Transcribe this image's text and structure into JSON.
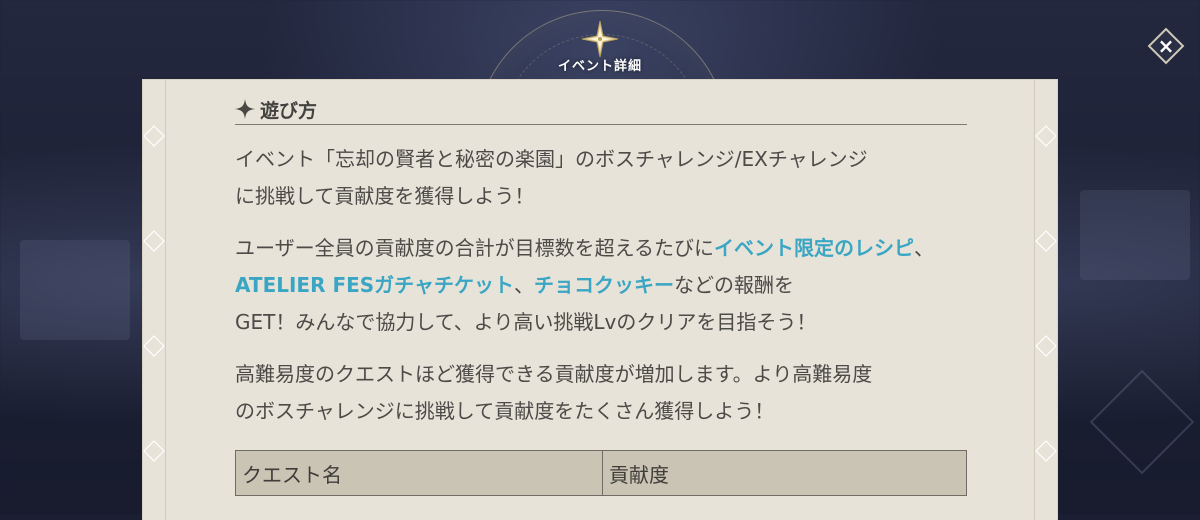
{
  "header": {
    "title": "イベント詳細",
    "emblem_icon": "compass-star-icon"
  },
  "close_button": {
    "label": "×",
    "icon": "close-icon"
  },
  "section": {
    "heading": "遊び方",
    "heading_icon": "sparkle-icon"
  },
  "paragraphs": {
    "p1_line1": "イベント「忘却の賢者と秘密の楽園」のボスチャレンジ/EXチャレンジ",
    "p1_line2": "に挑戦して貢献度を獲得しよう！",
    "p2_a": "ユーザー全員の貢献度の合計が目標数を超えるたびに",
    "p2_hl1": "イベント限定のレシピ",
    "p2_b": "、",
    "p2_hl2": "ATELIER FESガチャチケット",
    "p2_c": "、",
    "p2_hl3": "チョコクッキー",
    "p2_d": "などの報酬を",
    "p2_line3": "GET！みんなで協力して、より高い挑戦Lvのクリアを目指そう！",
    "p3_line1": "高難易度のクエストほど獲得できる貢献度が増加します。より高難易度",
    "p3_line2": "のボスチャレンジに挑戦して貢献度をたくさん獲得しよう！"
  },
  "table": {
    "headers": [
      "クエスト名",
      "貢献度"
    ]
  },
  "colors": {
    "highlight": "#3aa6c4",
    "panel_bg": "#e7e3d9",
    "text": "#4d4b48",
    "table_header_bg": "#c9c4b4"
  }
}
